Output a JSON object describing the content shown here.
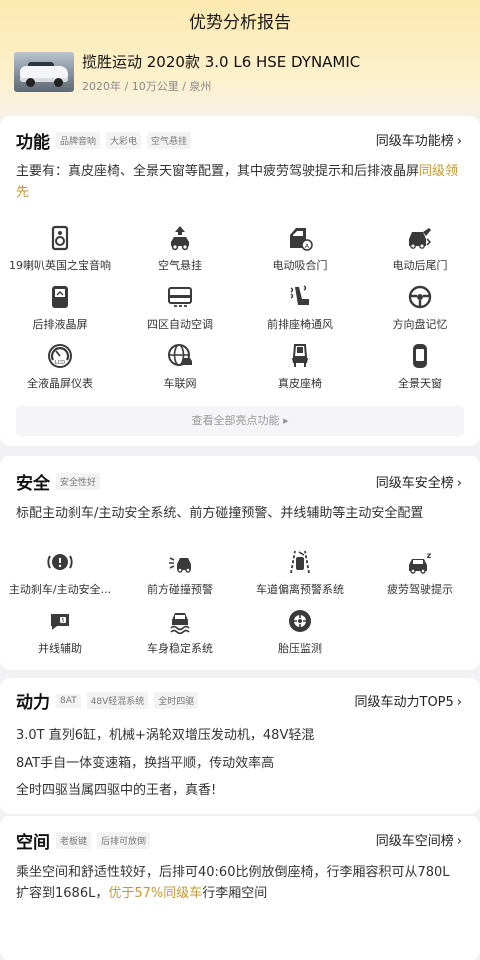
{
  "header": {
    "title": "优势分析报告"
  },
  "car": {
    "name": "揽胜运动 2020款 3.0 L6 HSE DYNAMIC",
    "meta": "2020年 / 10万公里 / 泉州"
  },
  "function": {
    "title": "功能",
    "tags": [
      "品牌音响",
      "大彩电",
      "空气悬挂"
    ],
    "rank_link": "同级车功能榜",
    "desc_main": "主要有：真皮座椅、全景天窗等配置，其中疲劳驾驶提示和后排液晶屏",
    "desc_highlight": "同级领先",
    "features": [
      {
        "label": "19喇叭英国之宝音响",
        "icon": "speaker-icon"
      },
      {
        "label": "空气悬挂",
        "icon": "air-suspension-icon"
      },
      {
        "label": "电动吸合门",
        "icon": "soft-close-door-icon"
      },
      {
        "label": "电动后尾门",
        "icon": "power-tailgate-icon"
      },
      {
        "label": "后排液晶屏",
        "icon": "rear-screen-icon"
      },
      {
        "label": "四区自动空调",
        "icon": "ac-icon"
      },
      {
        "label": "前排座椅通风",
        "icon": "seat-ventilation-icon"
      },
      {
        "label": "方向盘记忆",
        "icon": "steering-memory-icon"
      },
      {
        "label": "全液晶屏仪表",
        "icon": "lcd-gauge-icon"
      },
      {
        "label": "车联网",
        "icon": "connected-car-icon"
      },
      {
        "label": "真皮座椅",
        "icon": "leather-seat-icon"
      },
      {
        "label": "全景天窗",
        "icon": "panoramic-roof-icon"
      }
    ],
    "view_all": "查看全部亮点功能"
  },
  "safety": {
    "title": "安全",
    "tags": [
      "安全性好"
    ],
    "rank_link": "同级车安全榜",
    "desc": "标配主动刹车/主动安全系统、前方碰撞预警、并线辅助等主动安全配置",
    "features": [
      {
        "label": "主动刹车/主动安全...",
        "icon": "active-brake-icon"
      },
      {
        "label": "前方碰撞预警",
        "icon": "collision-warning-icon"
      },
      {
        "label": "车道偏离预警系统",
        "icon": "lane-departure-icon"
      },
      {
        "label": "疲劳驾驶提示",
        "icon": "fatigue-warning-icon"
      },
      {
        "label": "并线辅助",
        "icon": "lane-change-assist-icon"
      },
      {
        "label": "车身稳定系统",
        "icon": "stability-control-icon"
      },
      {
        "label": "胎压监测",
        "icon": "tire-pressure-icon"
      }
    ]
  },
  "power": {
    "title": "动力",
    "tags": [
      "8AT",
      "48V轻混系统",
      "全时四驱"
    ],
    "rank_link": "同级车动力TOP5",
    "lines": [
      "3.0T 直列6缸，机械+涡轮双增压发动机，48V轻混",
      "8AT手自一体变速箱，换挡平顺，传动效率高",
      "全时四驱当属四驱中的王者，真香!"
    ]
  },
  "space": {
    "title": "空间",
    "tags": [
      "老板键",
      "后排可放倒"
    ],
    "rank_link": "同级车空间榜",
    "desc_main": "乘坐空间和舒适性较好，后排可40:60比例放倒座椅，行李厢容积可从780L扩容到1686L，",
    "desc_highlight": "优于57%同级车",
    "desc_tail": "行李厢空间"
  },
  "colors": {
    "accent": "#c49a2f",
    "icon": "#3a3a3a"
  }
}
